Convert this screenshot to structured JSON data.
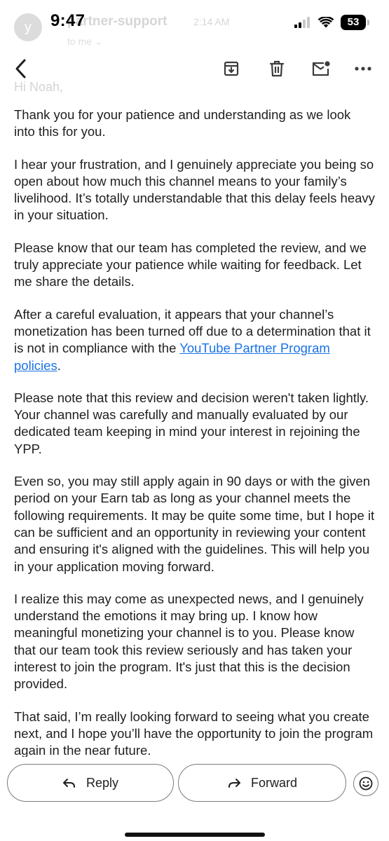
{
  "status_bar": {
    "time": "9:47",
    "battery": "53"
  },
  "background_header": {
    "avatar_letter": "y",
    "sender": "partner-support",
    "time": "2:14 AM",
    "to": "to me ⌄",
    "greeting": "Hi Noah,"
  },
  "toolbar": {
    "icons": [
      "back-arrow-icon",
      "archive-icon",
      "trash-icon",
      "mark-unread-icon",
      "more-horizontal-icon"
    ]
  },
  "email": {
    "paragraphs": [
      "Thank you for your patience and understanding as we look into this for you.",
      "I hear your frustration, and I genuinely appreciate you being so open about how much this channel means to your family’s livelihood. It’s totally understandable that this delay feels heavy in your situation.",
      "Please know that our team has completed the review, and we truly appreciate your patience while waiting for feedback. Let me share the details.",
      {
        "before": "After a careful evaluation, it appears that your channel’s monetization has been turned off due to a determination that it is not in compliance with the ",
        "link": "YouTube Partner Program policies",
        "after": "."
      },
      "Please note that this review and decision weren't taken lightly. Your channel was carefully and manually evaluated by our dedicated team keeping in mind your interest in rejoining the YPP.",
      "Even so, you may still apply again in 90 days or with the given period on your Earn tab as long as your channel meets the following requirements. It may be quite some time, but I hope it can be sufficient and an opportunity in reviewing your content and ensuring it's aligned with the guidelines. This will help you in your application moving forward.",
      "I realize this may come as unexpected news, and I genuinely understand the emotions it may bring up. I know how meaningful monetizing your channel is to you. Please know that our team took this review seriously and has taken your interest to join the program. It's just that this is the decision provided.",
      "That said, I’m really looking forward to seeing what you create next, and I hope you’ll have the opportunity to join the program again in the near future."
    ]
  },
  "actions": {
    "reply_label": "Reply",
    "forward_label": "Forward",
    "emoji_icon": "smiley-icon"
  }
}
